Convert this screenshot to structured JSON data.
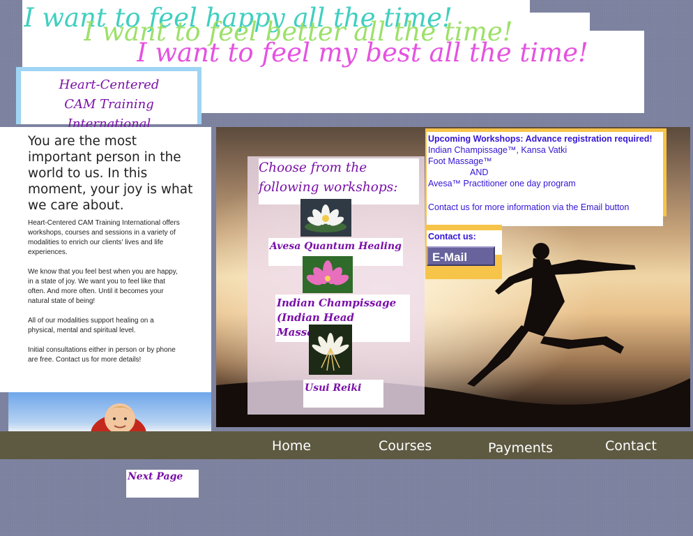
{
  "banner": {
    "tagline_1": "I want to feel happy all the time!",
    "tagline_2": "I want to feel better all the time!",
    "tagline_3": "I want to feel my best all the time!"
  },
  "logo": {
    "line1": "Heart-Centered",
    "line2": "CAM Training International"
  },
  "left": {
    "headline": "You are the most important person in the world to us. In this moment, your joy is what we care about.",
    "para1": "Heart-Centered CAM Training International offers workshops, courses and sessions in a variety of modalities to enrich our clients' lives and life experiences.",
    "para2": "We know that you feel best when you are happy, in a state of joy. We want you to feel like that often. And more often. Until it becomes your natural state of being!",
    "para3": "All of our modalities support healing on a physical, mental and spiritual level.",
    "para4": "Initial consultations either in person or by phone are free. Contact us for more details!"
  },
  "workshops": {
    "title": "Choose from the following workshops:",
    "items": [
      {
        "label": "Avesa Quantum Healing"
      },
      {
        "label": "Indian Champissage (Indian Head Massage)"
      },
      {
        "label": "Usui Reiki"
      }
    ]
  },
  "upcoming": {
    "heading": "Upcoming Workshops: Advance registration required!",
    "line1": "Indian Champissage™, Kansa Vatki",
    "line2": "Foot Massage™",
    "line3": "AND",
    "line4": "Avesa™ Practitioner one day program",
    "line5": "Contact us for more information via the Email button"
  },
  "contact": {
    "label": "Contact us:",
    "email_button": "E-Mail"
  },
  "nav": {
    "home": "Home",
    "courses": "Courses",
    "payments": "Payments",
    "contact": "Contact"
  },
  "next_page": "Next Page",
  "colors": {
    "accent_purple": "#7a0fa8",
    "link_blue": "#3314d3",
    "nav_bar": "#5e5a42",
    "frame_gold": "#f7c44a"
  }
}
